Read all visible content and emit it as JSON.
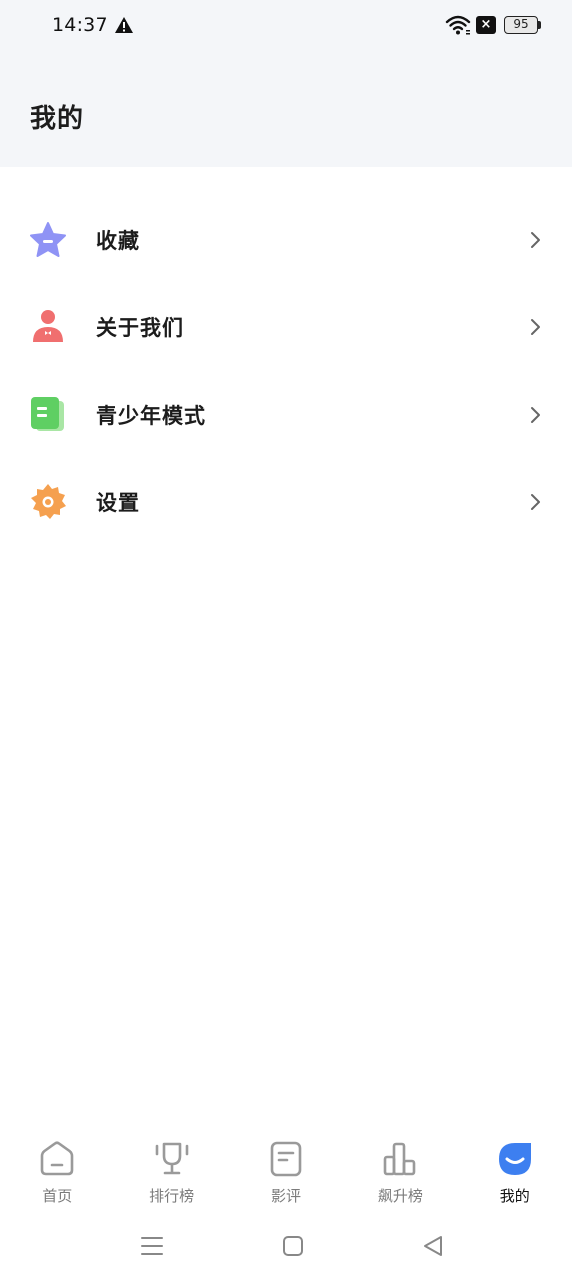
{
  "status_bar": {
    "time": "14:37",
    "battery": "95",
    "icons": [
      "warning-icon",
      "wifi-icon",
      "notification-x-icon",
      "battery-icon"
    ]
  },
  "header": {
    "title": "我的"
  },
  "menu": {
    "items": [
      {
        "label": "收藏",
        "icon": "star-icon",
        "color": "#8f93f5"
      },
      {
        "label": "关于我们",
        "icon": "person-icon",
        "color": "#f06f6f"
      },
      {
        "label": "青少年模式",
        "icon": "document-icon",
        "color": "#5fcf63"
      },
      {
        "label": "设置",
        "icon": "gear-icon",
        "color": "#f5a04f"
      }
    ]
  },
  "tabbar": {
    "tabs": [
      {
        "label": "首页",
        "icon": "home-icon",
        "active": false
      },
      {
        "label": "排行榜",
        "icon": "trophy-icon",
        "active": false
      },
      {
        "label": "影评",
        "icon": "review-icon",
        "active": false
      },
      {
        "label": "飙升榜",
        "icon": "bar-chart-icon",
        "active": false
      },
      {
        "label": "我的",
        "icon": "profile-icon",
        "active": true
      }
    ],
    "active_color": "#3d7ff0",
    "inactive_color": "#9a9a9a"
  },
  "system_nav": {
    "buttons": [
      "menu-icon",
      "home-square-icon",
      "back-triangle-icon"
    ]
  }
}
